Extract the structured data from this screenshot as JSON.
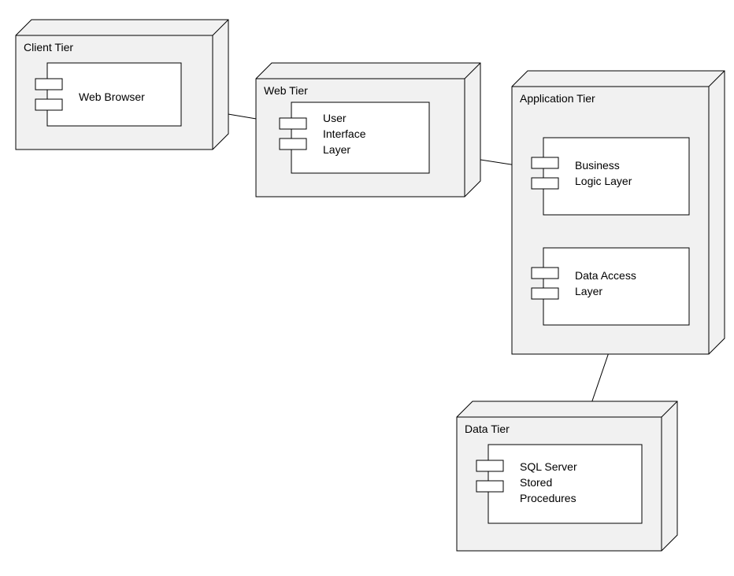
{
  "tiers": {
    "client": {
      "title": "Client Tier"
    },
    "web": {
      "title": "Web Tier"
    },
    "application": {
      "title": "Application Tier"
    },
    "data": {
      "title": "Data Tier"
    }
  },
  "components": {
    "webBrowser": {
      "l1": "Web Browser",
      "l2": "",
      "l3": ""
    },
    "uiLayer": {
      "l1": "User",
      "l2": "Interface",
      "l3": "Layer"
    },
    "bizLogic": {
      "l1": "Business",
      "l2": "Logic Layer",
      "l3": ""
    },
    "dataAccess": {
      "l1": "Data Access",
      "l2": "Layer",
      "l3": ""
    },
    "sqlServer": {
      "l1": "SQL Server",
      "l2": "Stored",
      "l3": "Procedures"
    }
  },
  "connections": [
    {
      "from": "webBrowser",
      "to": "uiLayer"
    },
    {
      "from": "uiLayer",
      "to": "bizLogic"
    },
    {
      "from": "bizLogic",
      "to": "dataAccess"
    },
    {
      "from": "dataAccess",
      "to": "sqlServer"
    }
  ]
}
